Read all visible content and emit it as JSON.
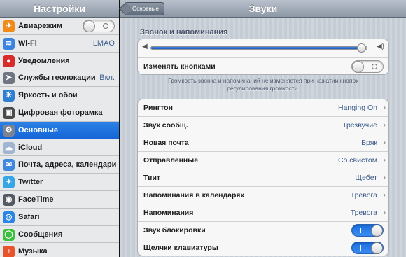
{
  "sidebar": {
    "title": "Настройки",
    "items": [
      {
        "label": "Авиарежим",
        "icon": "airplane-icon",
        "color": "#f08b1a",
        "glyph": "✈",
        "toggle": "off"
      },
      {
        "label": "Wi-Fi",
        "icon": "wifi-icon",
        "color": "#3a84e0",
        "glyph": "≋",
        "value": "LMAO"
      },
      {
        "label": "Уведомления",
        "icon": "notifications-icon",
        "color": "#d82b2b",
        "glyph": "●"
      },
      {
        "label": "Службы геолокации",
        "icon": "location-icon",
        "color": "#6e7682",
        "glyph": "➤",
        "value": "Вкл."
      },
      {
        "label": "Яркость и обои",
        "icon": "brightness-icon",
        "color": "#2f7fd1",
        "glyph": "☀"
      },
      {
        "label": "Цифровая фоторамка",
        "icon": "picture-frame-icon",
        "color": "#4a4a4a",
        "glyph": "▣"
      },
      {
        "label": "Основные",
        "icon": "gear-icon",
        "color": "#7b8490",
        "glyph": "⚙",
        "selected": true
      },
      {
        "label": "iCloud",
        "icon": "cloud-icon",
        "color": "#9fb5d0",
        "glyph": "☁"
      },
      {
        "label": "Почта, адреса, календари",
        "icon": "mail-icon",
        "color": "#3f88dc",
        "glyph": "✉"
      },
      {
        "label": "Twitter",
        "icon": "twitter-icon",
        "color": "#37a6e6",
        "glyph": "✦"
      },
      {
        "label": "FaceTime",
        "icon": "facetime-icon",
        "color": "#555b63",
        "glyph": "◉"
      },
      {
        "label": "Safari",
        "icon": "compass-icon",
        "color": "#2b86e4",
        "glyph": "◎"
      },
      {
        "label": "Сообщения",
        "icon": "messages-icon",
        "color": "#3cbf3c",
        "glyph": "◯"
      },
      {
        "label": "Музыка",
        "icon": "music-icon",
        "color": "#e8532c",
        "glyph": "♪"
      }
    ]
  },
  "header": {
    "title": "Звуки",
    "back_label": "Основные"
  },
  "ringer": {
    "section_title": "Звонок и напоминания",
    "volume_level": 0.97,
    "change_with_buttons_label": "Изменять кнопками",
    "change_with_buttons": "off",
    "hint": "Громкость звонка и напоминаний не изменяется при нажатии кнопок регулирования громкости."
  },
  "sounds": [
    {
      "label": "Рингтон",
      "value": "Hanging On"
    },
    {
      "label": "Звук сообщ.",
      "value": "Трезвучие"
    },
    {
      "label": "Новая почта",
      "value": "Бряк"
    },
    {
      "label": "Отправленные",
      "value": "Со свистом"
    },
    {
      "label": "Твит",
      "value": "Щебет"
    },
    {
      "label": "Напоминания в календарях",
      "value": "Тревога"
    },
    {
      "label": "Напоминания",
      "value": "Тревога"
    },
    {
      "label": "Звук блокировки",
      "toggle": "on"
    },
    {
      "label": "Щелчки клавиатуры",
      "toggle": "on"
    }
  ],
  "colors": {
    "accent": "#1f6fe0",
    "value_text": "#3c5a89"
  }
}
